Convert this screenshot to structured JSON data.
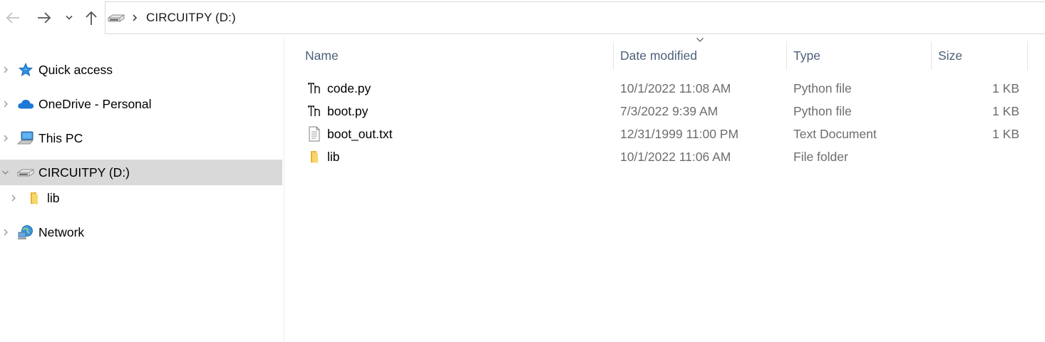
{
  "navigation": {
    "back_icon": "arrow-left-icon",
    "forward_icon": "arrow-right-icon",
    "recent_icon": "chevron-down-icon",
    "up_icon": "arrow-up-icon"
  },
  "address_bar": {
    "drive_icon": "usb-drive-icon",
    "path": "CIRCUITPY (D:)"
  },
  "nav_pane": {
    "items": [
      {
        "label": "Quick access",
        "icon": "star-icon"
      },
      {
        "label": "OneDrive - Personal",
        "icon": "cloud-icon"
      },
      {
        "label": "This PC",
        "icon": "computer-icon"
      },
      {
        "label": "CIRCUITPY (D:)",
        "icon": "usb-drive-icon",
        "selected": true
      },
      {
        "label": "lib",
        "icon": "folder-icon"
      },
      {
        "label": "Network",
        "icon": "network-icon"
      }
    ]
  },
  "file_list": {
    "columns": {
      "name": "Name",
      "date": "Date modified",
      "type": "Type",
      "size": "Size"
    },
    "sorted_by": "Date modified",
    "rows": [
      {
        "name": "code.py",
        "date": "10/1/2022 11:08 AM",
        "type": "Python file",
        "size": "1 KB",
        "icon": "python-file-icon"
      },
      {
        "name": "boot.py",
        "date": "7/3/2022 9:39 AM",
        "type": "Python file",
        "size": "1 KB",
        "icon": "python-file-icon"
      },
      {
        "name": "boot_out.txt",
        "date": "12/31/1999 11:00 PM",
        "type": "Text Document",
        "size": "1 KB",
        "icon": "text-file-icon"
      },
      {
        "name": "lib",
        "date": "10/1/2022 11:06 AM",
        "type": "File folder",
        "size": "",
        "icon": "folder-icon"
      }
    ]
  },
  "colors": {
    "header_text": "#4c607a",
    "selected_bg": "#d9d9d9",
    "secondary_text": "#6d6d6d",
    "folder_yellow": "#f4c54a",
    "onedrive_blue": "#1e78d6"
  }
}
